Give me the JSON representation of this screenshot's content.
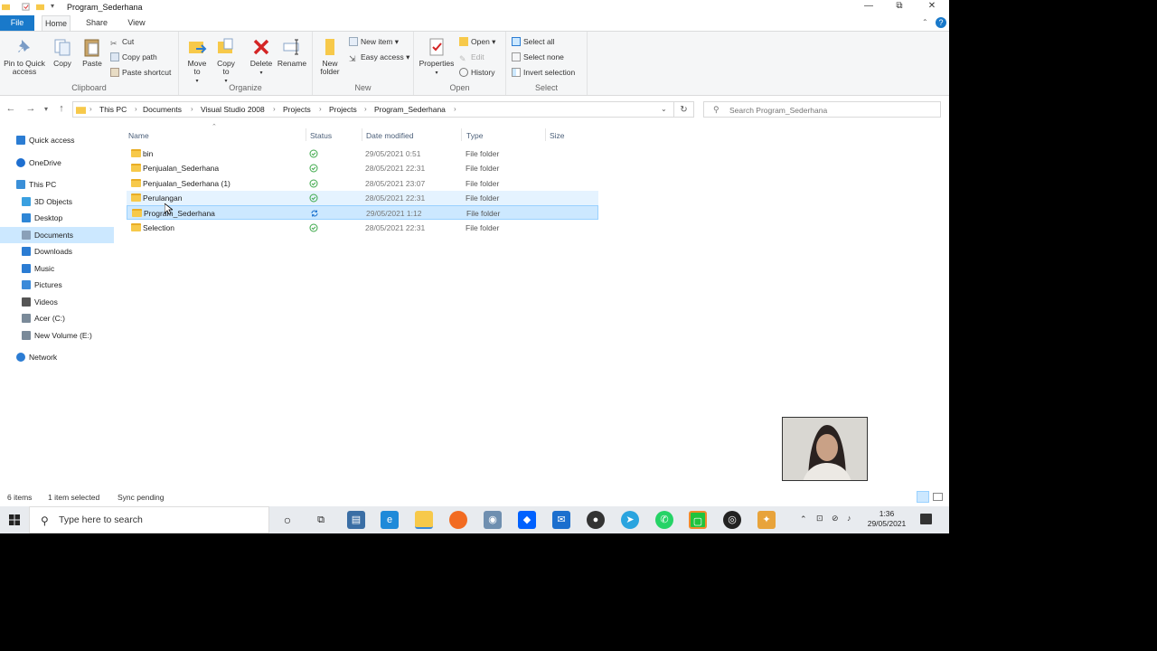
{
  "window": {
    "title": "Program_Sederhana",
    "controls": {
      "minimize": "—",
      "maximize": "⧉",
      "close": "✕"
    }
  },
  "ribbon": {
    "tabs": [
      "File",
      "Home",
      "Share",
      "View"
    ],
    "groups": {
      "clipboard": {
        "label": "Clipboard",
        "pin": "Pin to Quick access",
        "copy": "Copy",
        "paste": "Paste",
        "cut": "Cut",
        "copy_path": "Copy path",
        "paste_shortcut": "Paste shortcut"
      },
      "organize": {
        "label": "Organize",
        "move_to": "Move to",
        "copy_to": "Copy to",
        "delete": "Delete",
        "rename": "Rename"
      },
      "new": {
        "label": "New",
        "new_folder": "New folder",
        "new_item": "New item",
        "easy_access": "Easy access"
      },
      "open": {
        "label": "Open",
        "properties": "Properties",
        "open": "Open",
        "edit": "Edit",
        "history": "History"
      },
      "select": {
        "label": "Select",
        "select_all": "Select all",
        "select_none": "Select none",
        "invert_selection": "Invert selection"
      }
    }
  },
  "address": {
    "crumbs": [
      "This PC",
      "Documents",
      "Visual Studio 2008",
      "Projects",
      "Projects",
      "Program_Sederhana"
    ],
    "search_placeholder": "Search Program_Sederhana"
  },
  "nav_pane": {
    "items": [
      {
        "label": "Quick access",
        "icon": "star-icon",
        "color": "#2b7cd3"
      },
      {
        "label": "OneDrive",
        "icon": "cloud-icon",
        "color": "#1e6fd0"
      },
      {
        "label": "This PC",
        "icon": "computer-icon",
        "color": "#3a8fd8"
      },
      {
        "label": "3D Objects",
        "icon": "cube-icon",
        "color": "#3aa0e0"
      },
      {
        "label": "Desktop",
        "icon": "desktop-icon",
        "color": "#2e86d6"
      },
      {
        "label": "Documents",
        "icon": "documents-icon",
        "color": "#8aa0b8"
      },
      {
        "label": "Downloads",
        "icon": "download-icon",
        "color": "#2b7cd3"
      },
      {
        "label": "Music",
        "icon": "music-icon",
        "color": "#2b7cd3"
      },
      {
        "label": "Pictures",
        "icon": "pictures-icon",
        "color": "#3b8ad9"
      },
      {
        "label": "Videos",
        "icon": "videos-icon",
        "color": "#555"
      },
      {
        "label": "Acer (C:)",
        "icon": "drive-icon",
        "color": "#7a8a99"
      },
      {
        "label": "New Volume (E:)",
        "icon": "drive-icon",
        "color": "#7a8a99"
      },
      {
        "label": "Network",
        "icon": "network-icon",
        "color": "#2b7cd3"
      }
    ]
  },
  "file_list": {
    "columns": [
      "Name",
      "Status",
      "Date modified",
      "Type",
      "Size"
    ],
    "rows": [
      {
        "name": "bin",
        "status": "synced",
        "date": "29/05/2021 0:51",
        "type": "File folder"
      },
      {
        "name": "Penjualan_Sederhana",
        "status": "synced",
        "date": "28/05/2021 22:31",
        "type": "File folder"
      },
      {
        "name": "Penjualan_Sederhana (1)",
        "status": "synced",
        "date": "28/05/2021 23:07",
        "type": "File folder"
      },
      {
        "name": "Perulangan",
        "status": "synced",
        "date": "28/05/2021 22:31",
        "type": "File folder"
      },
      {
        "name": "Program_Sederhana",
        "status": "sync-pending",
        "date": "29/05/2021 1:12",
        "type": "File folder"
      },
      {
        "name": "Selection",
        "status": "synced",
        "date": "28/05/2021 22:31",
        "type": "File folder"
      }
    ]
  },
  "status_bar": {
    "item_count": "6 items",
    "selected": "1 item selected",
    "sync": "Sync pending"
  },
  "taskbar": {
    "search_placeholder": "Type here to search",
    "time": "1:36",
    "date": "29/05/2021"
  },
  "colors": {
    "accent": "#1979ca",
    "selection": "#cce8ff",
    "sync_ok": "#3da84a",
    "sync_pending": "#2b7cd3",
    "folder": "#f7c94a"
  }
}
